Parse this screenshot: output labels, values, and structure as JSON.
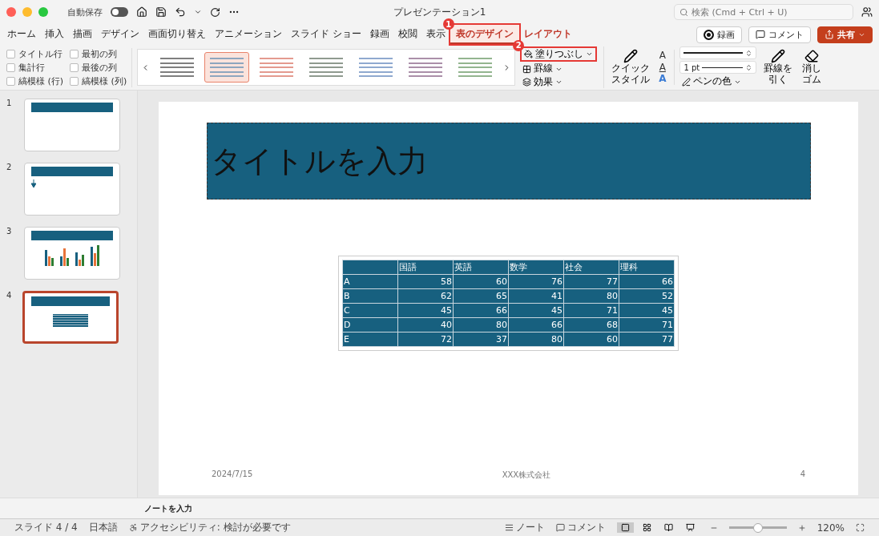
{
  "window": {
    "title": "プレゼンテーション1",
    "autosave_label": "自動保存",
    "autosave_on": false,
    "search_placeholder": "検索 (Cmd + Ctrl + U)"
  },
  "tabs": [
    {
      "label": "ホーム",
      "selected": false
    },
    {
      "label": "挿入",
      "selected": false
    },
    {
      "label": "描画",
      "selected": false
    },
    {
      "label": "デザイン",
      "selected": false
    },
    {
      "label": "画面切り替え",
      "selected": false
    },
    {
      "label": "アニメーション",
      "selected": false
    },
    {
      "label": "スライド ショー",
      "selected": false
    },
    {
      "label": "録画",
      "selected": false
    },
    {
      "label": "校閲",
      "selected": false
    },
    {
      "label": "表示",
      "selected": false
    },
    {
      "label": "表のデザイン",
      "selected": true,
      "callout": "1"
    },
    {
      "label": "レイアウト",
      "selected": false,
      "contextual": true
    }
  ],
  "header_buttons": [
    {
      "kind": "record",
      "label": "録画"
    },
    {
      "kind": "comment",
      "label": "コメント"
    },
    {
      "kind": "share",
      "label": "共有"
    }
  ],
  "ribbon": {
    "options": [
      {
        "label": "タイトル行",
        "checked": false
      },
      {
        "label": "最初の列",
        "checked": false
      },
      {
        "label": "集計行",
        "checked": false
      },
      {
        "label": "最後の列",
        "checked": false
      },
      {
        "label": "縞模様 (行)",
        "checked": false
      },
      {
        "label": "縞模様 (列)",
        "checked": false
      }
    ],
    "styles": [
      {
        "color": "#7f7f7f",
        "selected": false
      },
      {
        "color": "#8ea6bf",
        "selected": true
      },
      {
        "color": "#e49a8f",
        "selected": false
      },
      {
        "color": "#8f9a8f",
        "selected": false
      },
      {
        "color": "#8fa9cf",
        "selected": false
      },
      {
        "color": "#ab8fa9",
        "selected": false
      },
      {
        "color": "#93b58f",
        "selected": false
      }
    ],
    "fill_tools": [
      {
        "kind": "fill",
        "label": "塗りつぶし",
        "callout": "2"
      },
      {
        "kind": "border",
        "label": "罫線"
      },
      {
        "kind": "effect",
        "label": "効果"
      }
    ],
    "quick_style": [
      "クイック",
      "スタイル"
    ],
    "text_tools": [
      {
        "kind": "fill",
        "label": "A"
      },
      {
        "kind": "outline",
        "label": "A"
      },
      {
        "kind": "effect",
        "label": "A"
      }
    ],
    "line_weight": "1 pt",
    "pen_color": "ペンの色",
    "draw_border": [
      "罫線を",
      "引く"
    ],
    "eraser": [
      "消し",
      "ゴム"
    ]
  },
  "slides": [
    {
      "number": "1",
      "kind": "title",
      "selected": false
    },
    {
      "number": "2",
      "kind": "arrow",
      "selected": false
    },
    {
      "number": "3",
      "kind": "chart",
      "selected": false
    },
    {
      "number": "4",
      "kind": "table",
      "selected": true
    }
  ],
  "slide": {
    "title": "タイトルを入力",
    "table": {
      "columns": [
        "",
        "国語",
        "英語",
        "数学",
        "社会",
        "理科"
      ],
      "rows": [
        [
          "A",
          "58",
          "60",
          "76",
          "77",
          "66"
        ],
        [
          "B",
          "62",
          "65",
          "41",
          "80",
          "52"
        ],
        [
          "C",
          "45",
          "66",
          "45",
          "71",
          "45"
        ],
        [
          "D",
          "40",
          "80",
          "66",
          "68",
          "71"
        ],
        [
          "E",
          "72",
          "37",
          "80",
          "60",
          "77"
        ]
      ]
    },
    "footer_date": "2024/7/15",
    "footer_text": "XXX株式会社",
    "page_number": "4"
  },
  "notes_placeholder": "ノートを入力",
  "status_bar": {
    "slide": "スライド 4 / 4",
    "language": "日本語",
    "accessibility": "アクセシビリティ: 検討が必要です",
    "notes": "ノート",
    "comments": "コメント",
    "views": [
      {
        "kind": "normal",
        "selected": true
      },
      {
        "kind": "sorter",
        "selected": false
      },
      {
        "kind": "reading",
        "selected": false
      },
      {
        "kind": "show",
        "selected": false
      }
    ],
    "zoom": {
      "level": 0.5,
      "reading": "120%"
    }
  }
}
